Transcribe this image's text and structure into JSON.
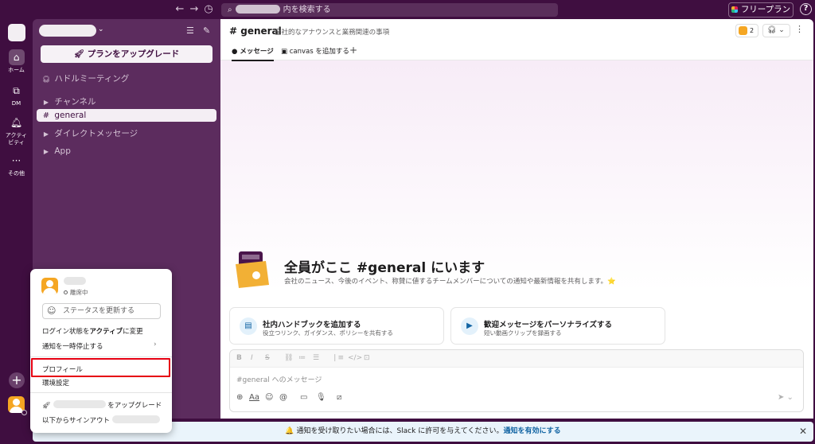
{
  "topbar": {
    "search_suffix": "内を検索する",
    "plan_button": "フリープラン",
    "help_label": "?"
  },
  "rail": {
    "items": [
      {
        "label": "ホーム",
        "icon": "home-icon"
      },
      {
        "label": "DM",
        "icon": "dm-icon"
      },
      {
        "label": "アクティビティ",
        "icon": "bell-icon"
      },
      {
        "label": "その他",
        "icon": "more-icon"
      }
    ],
    "add_label": "+"
  },
  "sidebar": {
    "upgrade_button": "プランをアップグレード",
    "huddles": "ハドルミーティング",
    "channels_header": "チャンネル",
    "channel_general": "general",
    "dm_header": "ダイレクトメッセージ",
    "apps_header": "App"
  },
  "channel": {
    "name": "# general",
    "description": "全社的なアナウンスと業務関連の事項",
    "member_count": "2",
    "tab_messages": "メッセージ",
    "tab_canvas": "canvas を追加する",
    "welcome_title": "全員がここ #general にいます",
    "welcome_sub": "会社のニュース、今後のイベント、称賛に値するチームメンバーについての通知や最新情報を共有します。⭐",
    "cards": [
      {
        "title": "社内ハンドブックを追加する",
        "sub": "役立つリンク、ガイダンス、ポリシーを共有する"
      },
      {
        "title": "歓迎メッセージをパーソナライズする",
        "sub": "短い動画クリップを録画する"
      }
    ],
    "composer_placeholder": "#general へのメッセージ"
  },
  "notification": {
    "text": "🔔 通知を受け取りたい場合には、Slack に許可を与えてください。",
    "link": "通知を有効にする",
    "close": "✕"
  },
  "menu": {
    "status": "離席中",
    "status_placeholder": "ステータスを更新する",
    "login_prefix": "ログイン状態を",
    "login_bold": "アクティブ",
    "login_suffix": "に変更",
    "pause": "通知を一時停止する",
    "profile": "プロフィール",
    "preferences": "環境設定",
    "upgrade_suffix": "をアップグレード",
    "signout_prefix": "以下からサインアウト"
  },
  "colors": {
    "aubergine": "#3f0e40",
    "sidebar": "#5c2c5e",
    "highlight_red": "#e60012",
    "link_blue": "#1264a3"
  }
}
